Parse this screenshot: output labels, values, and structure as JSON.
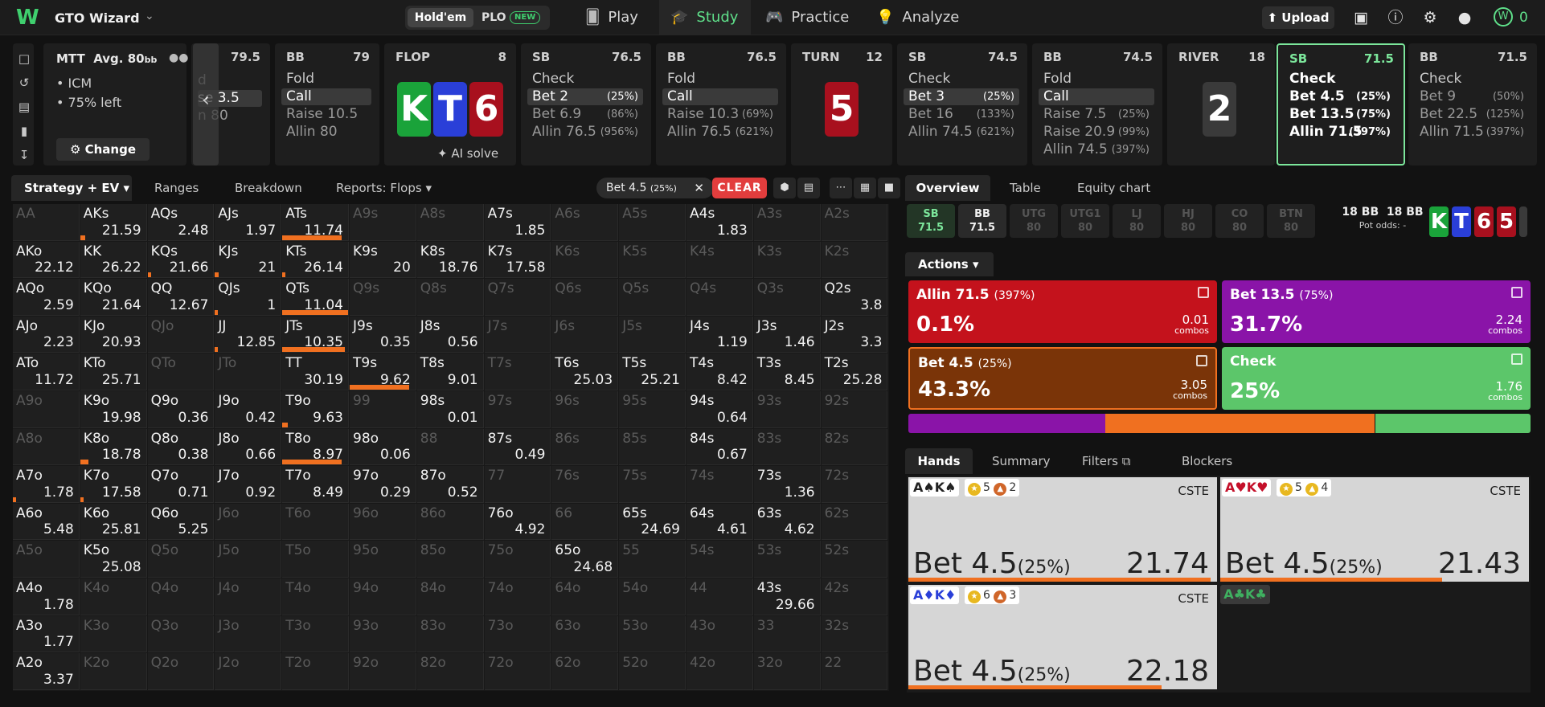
{
  "app": {
    "title": "GTO Wizard",
    "logo": "W"
  },
  "game_toggle": {
    "holdem": "Hold'em",
    "plo": "PLO",
    "plo_badge": "NEW"
  },
  "nav": [
    {
      "label": "Play",
      "icon": "cards-icon"
    },
    {
      "label": "Study",
      "icon": "graduation-cap-icon"
    },
    {
      "label": "Practice",
      "icon": "gamepad-icon"
    },
    {
      "label": "Analyze",
      "icon": "bulb-icon"
    }
  ],
  "topbar": {
    "upload": "Upload",
    "points": "0",
    "points_coin": "W"
  },
  "mtt": {
    "title": "MTT",
    "avg_label": "Avg. 80",
    "avg_unit": "bb",
    "line1": "ICM",
    "line2": "75% left",
    "change": "Change"
  },
  "strip": {
    "partial": {
      "stack": "79.5",
      "a0": "d",
      "a1": "se 3.5",
      "a2": "n 80"
    },
    "bb1": {
      "pos": "BB",
      "stack": "79",
      "a0": "Fold",
      "a1": "Call",
      "a2": "Raise 10.5",
      "a3": "Allin 80"
    },
    "flop": {
      "label": "FLOP",
      "count": "8",
      "cards": [
        "K",
        "T",
        "6"
      ],
      "ai": "AI solve"
    },
    "sb1": {
      "pos": "SB",
      "stack": "76.5",
      "a0": "Check",
      "a1": "Bet 2",
      "a1p": "(25%)",
      "a2": "Bet 6.9",
      "a2p": "(86%)",
      "a3": "Allin 76.5",
      "a3p": "(956%)"
    },
    "bb2": {
      "pos": "BB",
      "stack": "76.5",
      "a0": "Fold",
      "a1": "Call",
      "a2": "Raise 10.3",
      "a2p": "(69%)",
      "a3": "Allin 76.5",
      "a3p": "(621%)"
    },
    "turn": {
      "label": "TURN",
      "count": "12",
      "card": "5"
    },
    "sb2": {
      "pos": "SB",
      "stack": "74.5",
      "a0": "Check",
      "a1": "Bet 3",
      "a1p": "(25%)",
      "a2": "Bet 16",
      "a2p": "(133%)",
      "a3": "Allin 74.5",
      "a3p": "(621%)"
    },
    "bb3": {
      "pos": "BB",
      "stack": "74.5",
      "a0": "Fold",
      "a1": "Call",
      "a2": "Raise 7.5",
      "a2p": "(25%)",
      "a3": "Raise 20.9",
      "a3p": "(99%)",
      "a4": "Allin 74.5",
      "a4p": "(397%)"
    },
    "river": {
      "label": "RIVER",
      "count": "18",
      "card": "2"
    },
    "sb3": {
      "pos": "SB",
      "stack": "71.5",
      "a0": "Check",
      "a1": "Bet 4.5",
      "a1p": "(25%)",
      "a2": "Bet 13.5",
      "a2p": "(75%)",
      "a3": "Allin 71.5",
      "a3p": "(397%)"
    },
    "bb4": {
      "pos": "BB",
      "stack": "71.5",
      "a0": "Check",
      "a1": "Bet 9",
      "a1p": "(50%)",
      "a2": "Bet 22.5",
      "a2p": "(125%)",
      "a3": "Allin 71.5",
      "a3p": "(397%)"
    }
  },
  "left_tabs": {
    "strategy": "Strategy + EV",
    "ranges": "Ranges",
    "breakdown": "Breakdown",
    "reports": "Reports: Flops",
    "filter": "Bet 4.5",
    "filter_pct": "(25%)",
    "clear": "CLEAR"
  },
  "matrix": [
    [
      [
        "AA",
        ""
      ],
      [
        "AKs",
        "21.59"
      ],
      [
        "AQs",
        "2.48"
      ],
      [
        "AJs",
        "1.97"
      ],
      [
        "ATs",
        "11.74"
      ],
      [
        "A9s",
        ""
      ],
      [
        "A8s",
        ""
      ],
      [
        "A7s",
        "1.85"
      ],
      [
        "A6s",
        ""
      ],
      [
        "A5s",
        ""
      ],
      [
        "A4s",
        "1.83"
      ],
      [
        "A3s",
        ""
      ],
      [
        "A2s",
        ""
      ]
    ],
    [
      [
        "AKo",
        "22.12"
      ],
      [
        "KK",
        "26.22"
      ],
      [
        "KQs",
        "21.66"
      ],
      [
        "KJs",
        "21"
      ],
      [
        "KTs",
        "26.14"
      ],
      [
        "K9s",
        "20"
      ],
      [
        "K8s",
        "18.76"
      ],
      [
        "K7s",
        "17.58"
      ],
      [
        "K6s",
        ""
      ],
      [
        "K5s",
        ""
      ],
      [
        "K4s",
        ""
      ],
      [
        "K3s",
        ""
      ],
      [
        "K2s",
        ""
      ]
    ],
    [
      [
        "AQo",
        "2.59"
      ],
      [
        "KQo",
        "21.64"
      ],
      [
        "QQ",
        "12.67"
      ],
      [
        "QJs",
        "1"
      ],
      [
        "QTs",
        "11.04"
      ],
      [
        "Q9s",
        ""
      ],
      [
        "Q8s",
        ""
      ],
      [
        "Q7s",
        ""
      ],
      [
        "Q6s",
        ""
      ],
      [
        "Q5s",
        ""
      ],
      [
        "Q4s",
        ""
      ],
      [
        "Q3s",
        ""
      ],
      [
        "Q2s",
        "3.8"
      ]
    ],
    [
      [
        "AJo",
        "2.23"
      ],
      [
        "KJo",
        "20.93"
      ],
      [
        "QJo",
        ""
      ],
      [
        "JJ",
        "12.85"
      ],
      [
        "JTs",
        "10.35"
      ],
      [
        "J9s",
        "0.35"
      ],
      [
        "J8s",
        "0.56"
      ],
      [
        "J7s",
        ""
      ],
      [
        "J6s",
        ""
      ],
      [
        "J5s",
        ""
      ],
      [
        "J4s",
        "1.19"
      ],
      [
        "J3s",
        "1.46"
      ],
      [
        "J2s",
        "3.3"
      ]
    ],
    [
      [
        "ATo",
        "11.72"
      ],
      [
        "KTo",
        "25.71"
      ],
      [
        "QTo",
        ""
      ],
      [
        "JTo",
        ""
      ],
      [
        "TT",
        "30.19"
      ],
      [
        "T9s",
        "9.62"
      ],
      [
        "T8s",
        "9.01"
      ],
      [
        "T7s",
        ""
      ],
      [
        "T6s",
        "25.03"
      ],
      [
        "T5s",
        "25.21"
      ],
      [
        "T4s",
        "8.42"
      ],
      [
        "T3s",
        "8.45"
      ],
      [
        "T2s",
        "25.28"
      ]
    ],
    [
      [
        "A9o",
        ""
      ],
      [
        "K9o",
        "19.98"
      ],
      [
        "Q9o",
        "0.36"
      ],
      [
        "J9o",
        "0.42"
      ],
      [
        "T9o",
        "9.63"
      ],
      [
        "99",
        ""
      ],
      [
        "98s",
        "0.01"
      ],
      [
        "97s",
        ""
      ],
      [
        "96s",
        ""
      ],
      [
        "95s",
        ""
      ],
      [
        "94s",
        "0.64"
      ],
      [
        "93s",
        ""
      ],
      [
        "92s",
        ""
      ]
    ],
    [
      [
        "A8o",
        ""
      ],
      [
        "K8o",
        "18.78"
      ],
      [
        "Q8o",
        "0.38"
      ],
      [
        "J8o",
        "0.66"
      ],
      [
        "T8o",
        "8.97"
      ],
      [
        "98o",
        "0.06"
      ],
      [
        "88",
        ""
      ],
      [
        "87s",
        "0.49"
      ],
      [
        "86s",
        ""
      ],
      [
        "85s",
        ""
      ],
      [
        "84s",
        "0.67"
      ],
      [
        "83s",
        ""
      ],
      [
        "82s",
        ""
      ]
    ],
    [
      [
        "A7o",
        "1.78"
      ],
      [
        "K7o",
        "17.58"
      ],
      [
        "Q7o",
        "0.71"
      ],
      [
        "J7o",
        "0.92"
      ],
      [
        "T7o",
        "8.49"
      ],
      [
        "97o",
        "0.29"
      ],
      [
        "87o",
        "0.52"
      ],
      [
        "77",
        ""
      ],
      [
        "76s",
        ""
      ],
      [
        "75s",
        ""
      ],
      [
        "74s",
        ""
      ],
      [
        "73s",
        "1.36"
      ],
      [
        "72s",
        ""
      ]
    ],
    [
      [
        "A6o",
        "5.48"
      ],
      [
        "K6o",
        "25.81"
      ],
      [
        "Q6o",
        "5.25"
      ],
      [
        "J6o",
        ""
      ],
      [
        "T6o",
        ""
      ],
      [
        "96o",
        ""
      ],
      [
        "86o",
        ""
      ],
      [
        "76o",
        "4.92"
      ],
      [
        "66",
        ""
      ],
      [
        "65s",
        "24.69"
      ],
      [
        "64s",
        "4.61"
      ],
      [
        "63s",
        "4.62"
      ],
      [
        "62s",
        ""
      ]
    ],
    [
      [
        "A5o",
        ""
      ],
      [
        "K5o",
        "25.08"
      ],
      [
        "Q5o",
        ""
      ],
      [
        "J5o",
        ""
      ],
      [
        "T5o",
        ""
      ],
      [
        "95o",
        ""
      ],
      [
        "85o",
        ""
      ],
      [
        "75o",
        ""
      ],
      [
        "65o",
        "24.68"
      ],
      [
        "55",
        ""
      ],
      [
        "54s",
        ""
      ],
      [
        "53s",
        ""
      ],
      [
        "52s",
        ""
      ]
    ],
    [
      [
        "A4o",
        "1.78"
      ],
      [
        "K4o",
        ""
      ],
      [
        "Q4o",
        ""
      ],
      [
        "J4o",
        ""
      ],
      [
        "T4o",
        ""
      ],
      [
        "94o",
        ""
      ],
      [
        "84o",
        ""
      ],
      [
        "74o",
        ""
      ],
      [
        "64o",
        ""
      ],
      [
        "54o",
        ""
      ],
      [
        "44",
        ""
      ],
      [
        "43s",
        "29.66"
      ],
      [
        "42s",
        ""
      ]
    ],
    [
      [
        "A3o",
        "1.77"
      ],
      [
        "K3o",
        ""
      ],
      [
        "Q3o",
        ""
      ],
      [
        "J3o",
        ""
      ],
      [
        "T3o",
        ""
      ],
      [
        "93o",
        ""
      ],
      [
        "83o",
        ""
      ],
      [
        "73o",
        ""
      ],
      [
        "63o",
        ""
      ],
      [
        "53o",
        ""
      ],
      [
        "43o",
        ""
      ],
      [
        "33",
        ""
      ],
      [
        "32s",
        ""
      ]
    ],
    [
      [
        "A2o",
        "3.37"
      ],
      [
        "K2o",
        ""
      ],
      [
        "Q2o",
        ""
      ],
      [
        "J2o",
        ""
      ],
      [
        "T2o",
        ""
      ],
      [
        "92o",
        ""
      ],
      [
        "82o",
        ""
      ],
      [
        "72o",
        ""
      ],
      [
        "62o",
        ""
      ],
      [
        "52o",
        ""
      ],
      [
        "42o",
        ""
      ],
      [
        "32o",
        ""
      ],
      [
        "22",
        ""
      ]
    ]
  ],
  "matrix_bars": {
    "AKs": 0.08,
    "ATs": 0.9,
    "KQs": 0.05,
    "KJs": 0.06,
    "KTs": 0.05,
    "QTs": 1.0,
    "QJs": 0.04,
    "JJ": 0.05,
    "JTs": 0.95,
    "T9s": 0.9,
    "T9o": 0.08,
    "K8o": 0.12,
    "T8o": 0.9,
    "K7o": 0.05,
    "A7o": 0.05
  },
  "right_tabs": {
    "overview": "Overview",
    "table": "Table",
    "equity": "Equity chart"
  },
  "players": [
    {
      "pos": "SB",
      "stack": "71.5"
    },
    {
      "pos": "BB",
      "stack": "71.5"
    },
    {
      "pos": "UTG",
      "stack": "80"
    },
    {
      "pos": "UTG1",
      "stack": "80"
    },
    {
      "pos": "LJ",
      "stack": "80"
    },
    {
      "pos": "HJ",
      "stack": "80"
    },
    {
      "pos": "CO",
      "stack": "80"
    },
    {
      "pos": "BTN",
      "stack": "80"
    }
  ],
  "pot": {
    "a": "18 BB",
    "b": "18 BB",
    "odds_label": "Pot odds:",
    "odds_value": "-"
  },
  "board_mini": [
    "K",
    "T",
    "6",
    "5"
  ],
  "actions_tab": "Actions",
  "actions": [
    {
      "name": "Allin 71.5",
      "pct_label": "(397%)",
      "freq": "0.1%",
      "combos": "0.01",
      "unit": "combos",
      "color": "#c4121c"
    },
    {
      "name": "Bet 13.5",
      "pct_label": "(75%)",
      "freq": "31.7%",
      "combos": "2.24",
      "unit": "combos",
      "color": "#8a14a8"
    },
    {
      "name": "Bet 4.5",
      "pct_label": "(25%)",
      "freq": "43.3%",
      "combos": "3.05",
      "unit": "combos",
      "color": "#7a3408"
    },
    {
      "name": "Check",
      "pct_label": "",
      "freq": "25%",
      "combos": "1.76",
      "unit": "combos",
      "color": "#5cc66a"
    }
  ],
  "freq_bar": [
    {
      "name": "Allin",
      "value": 0.001,
      "color": "#c4121c"
    },
    {
      "name": "Bet 13.5",
      "value": 0.317,
      "color": "#8a14a8"
    },
    {
      "name": "Bet 4.5",
      "value": 0.433,
      "color": "#f07020"
    },
    {
      "name": "Check",
      "value": 0.25,
      "color": "#5cc66a"
    }
  ],
  "hand_tabs": {
    "hands": "Hands",
    "summary": "Summary",
    "filters": "Filters",
    "blockers": "Blockers"
  },
  "hands": [
    {
      "combo_a": "A♠",
      "combo_b": "K♠",
      "b1": "5",
      "b2": "2",
      "tag": "CSTE",
      "action": "Bet 4.5",
      "pct": "(25%)",
      "ev": "21.74",
      "freq": 0.98
    },
    {
      "combo_a": "A♥",
      "combo_b": "K♥",
      "b1": "5",
      "b2": "4",
      "tag": "CSTE",
      "action": "Bet 4.5",
      "pct": "(25%)",
      "ev": "21.43",
      "freq": 0.72
    },
    {
      "combo_a": "A♦",
      "combo_b": "K♦",
      "b1": "6",
      "b2": "3",
      "tag": "CSTE",
      "action": "Bet 4.5",
      "pct": "(25%)",
      "ev": "22.18",
      "freq": 0.82
    }
  ],
  "hand_acac": "A♣K♣"
}
